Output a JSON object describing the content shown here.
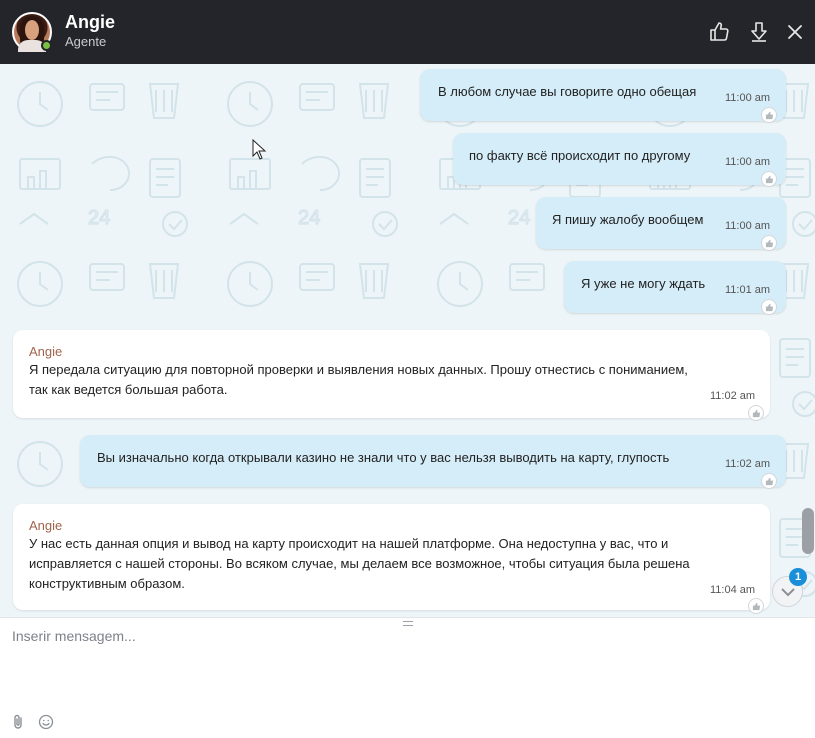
{
  "header": {
    "agent_name": "Angie",
    "agent_role": "Agente",
    "status": "online",
    "actions": [
      "thumbs-up-icon",
      "download-icon",
      "close-icon"
    ]
  },
  "messages": [
    {
      "direction": "out",
      "text": "В любом случае вы говорите одно обещая",
      "time": "11:00 am"
    },
    {
      "direction": "out",
      "text": "по факту всё происходит по другому",
      "time": "11:00 am"
    },
    {
      "direction": "out",
      "text": "Я пишу жалобу вообщем",
      "time": "11:00 am"
    },
    {
      "direction": "out",
      "text": "Я уже не могу ждать",
      "time": "11:01 am"
    },
    {
      "direction": "in",
      "sender": "Angie",
      "lines": [
        "Я передала ситуацию для повторной проверки и выявления новых данных. Прошу отнестись с пониманием,",
        "так как ведется большая работа."
      ],
      "time": "11:02 am"
    },
    {
      "direction": "out",
      "text": "Вы изначально когда открывали казино не знали что у вас нельзя выводить на карту, глупость",
      "time": "11:02 am"
    },
    {
      "direction": "in",
      "sender": "Angie",
      "lines": [
        "У нас есть данная опция и вывод на карту происходит на нашей платформе. Она недоступна у вас, что и",
        "исправляется с нашей стороны. Во всяком случае, мы делаем все возможное, чтобы ситуация была решена",
        "конструктивным образом."
      ],
      "time": "11:04 am"
    }
  ],
  "unread_count": "1",
  "composer": {
    "placeholder": "Inserir mensagem..."
  },
  "colors": {
    "header_bg": "#23252a",
    "outgoing_bubble": "#d5edf8",
    "incoming_bubble": "#ffffff",
    "sender_name": "#a0644c",
    "badge": "#1a8fd9",
    "online": "#7bc043"
  }
}
